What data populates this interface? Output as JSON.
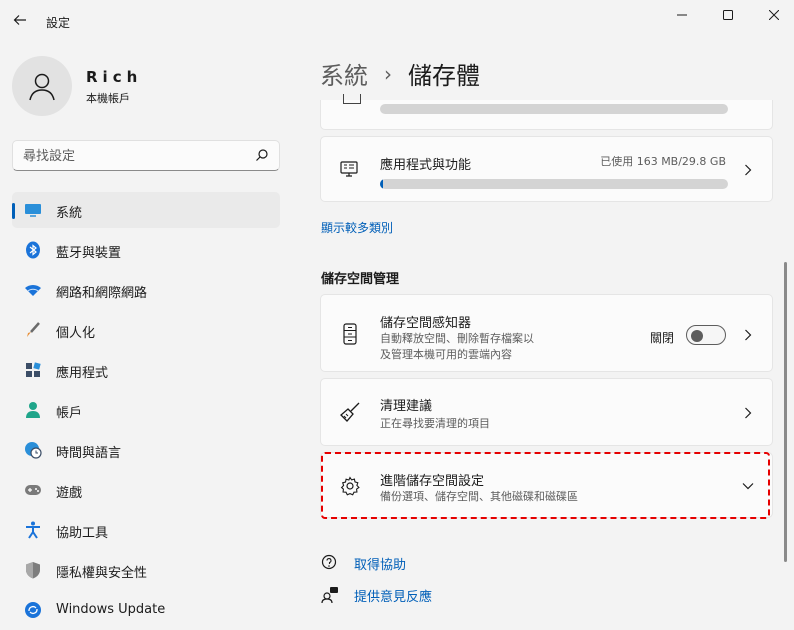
{
  "window": {
    "title": "設定",
    "controls": {
      "minimize": "minimize-icon",
      "maximize": "maximize-icon",
      "close": "close-icon"
    }
  },
  "profile": {
    "name": "Rich",
    "account_type": "本機帳戶"
  },
  "search": {
    "placeholder": "尋找設定",
    "value": ""
  },
  "sidebar": {
    "items": [
      {
        "label": "系統",
        "icon": "display-icon",
        "active": true
      },
      {
        "label": "藍牙與裝置",
        "icon": "bluetooth-icon"
      },
      {
        "label": "網路和網際網路",
        "icon": "wifi-icon"
      },
      {
        "label": "個人化",
        "icon": "brush-icon"
      },
      {
        "label": "應用程式",
        "icon": "apps-icon"
      },
      {
        "label": "帳戶",
        "icon": "person-icon"
      },
      {
        "label": "時間與語言",
        "icon": "globe-clock-icon"
      },
      {
        "label": "遊戲",
        "icon": "gamepad-icon"
      },
      {
        "label": "協助工具",
        "icon": "accessibility-icon"
      },
      {
        "label": "隱私權與安全性",
        "icon": "shield-icon"
      },
      {
        "label": "Windows Update",
        "icon": "update-icon"
      }
    ]
  },
  "breadcrumb": {
    "parent": "系統",
    "separator": "›",
    "current": "儲存體"
  },
  "storage": {
    "apps": {
      "title": "應用程式與功能",
      "usage": "已使用 163 MB/29.8 GB",
      "used_fraction": 0.0055
    },
    "show_more_link": "顯示較多類別"
  },
  "management": {
    "section_title": "儲存空間管理",
    "sense": {
      "title": "儲存空間感知器",
      "desc_line1": "自動釋放空間、刪除暫存檔案以",
      "desc_line2": "及管理本機可用的雲端內容",
      "toggle_label": "關閉",
      "toggle_on": false
    },
    "cleanup": {
      "title": "清理建議",
      "desc": "正在尋找要清理的項目"
    },
    "advanced": {
      "title": "進階儲存空間設定",
      "desc": "備份選項、儲存空間、其他磁碟和磁碟區"
    }
  },
  "help": {
    "get_help": "取得協助",
    "feedback": "提供意見反應"
  },
  "colors": {
    "accent": "#005fb8",
    "highlight": "#e60000"
  }
}
